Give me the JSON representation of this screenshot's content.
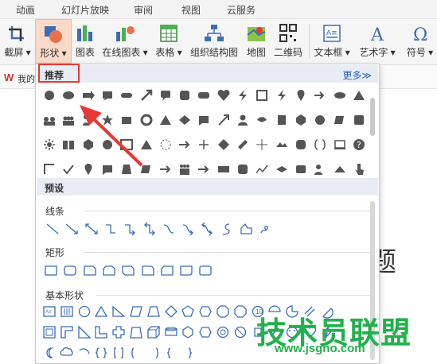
{
  "menu": {
    "tabs": [
      "动画",
      "幻灯片放映",
      "审阅",
      "视图",
      "云服务"
    ]
  },
  "ribbon": {
    "screenshot": "截屏 ▾",
    "shapes": "形状 ▾",
    "chart": "图表",
    "online_chart": "在线图表 ▾",
    "table": "表格 ▾",
    "org_chart": "组织结构图",
    "map": "地图",
    "qrcode": "二维码",
    "textbox": "文本框 ▾",
    "wordart": "艺术字 ▾",
    "symbol": "符号 ▾"
  },
  "wps_row": {
    "text": "我的"
  },
  "panel": {
    "recommended": "推荐",
    "more": "更多≫",
    "preset": "预设",
    "lines": "线条",
    "rect": "矩形",
    "basic": "基本形状"
  },
  "doc": {
    "title_fragment": "题"
  },
  "watermark": {
    "cn": "技术员联盟",
    "url": "www.jsgho.com"
  },
  "colors": {
    "accent_red": "#e53935",
    "shape_gray": "#555555",
    "preset_blue": "#3a6db5",
    "watermark_green": "#22b14c"
  }
}
